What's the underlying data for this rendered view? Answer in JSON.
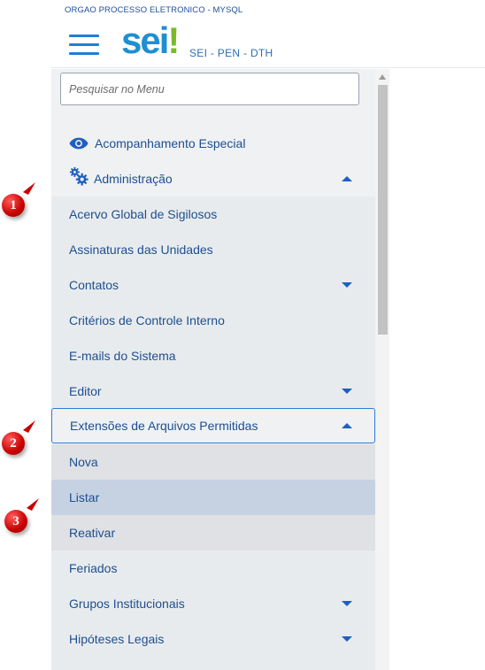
{
  "header": {
    "org_label": "ORGAO PROCESSO ELETRONICO - MYSQL",
    "logo_text": "sei",
    "logo_mark": "!",
    "subtitle": "SEI - PEN - DTH",
    "menu_icon": "hamburger-menu-icon"
  },
  "search": {
    "placeholder": "Pesquisar no Menu",
    "value": ""
  },
  "menu": {
    "acompanhamento": "Acompanhamento Especial",
    "administracao": "Administração",
    "sub_items": {
      "acervo": "Acervo Global de Sigilosos",
      "assinaturas": "Assinaturas das Unidades",
      "contatos": "Contatos",
      "criterios": "Critérios de Controle Interno",
      "emails": "E-mails do Sistema",
      "editor": "Editor",
      "extensoes": "Extensões de Arquivos Permitidas",
      "feriados": "Feriados",
      "grupos": "Grupos Institucionais",
      "hipoteses": "Hipóteses Legais"
    },
    "extensoes_children": {
      "nova": "Nova",
      "listar": "Listar",
      "reativar": "Reativar"
    },
    "selected_item": "Listar"
  },
  "annotations": [
    "1",
    "2",
    "3"
  ],
  "colors": {
    "link": "#1d4f8f",
    "accent": "#1f7fd6",
    "logo_blue": "#1e8fd2",
    "logo_green": "#7ab929",
    "selected_bg": "#c6d2e2",
    "badge_red": "#c80000"
  }
}
